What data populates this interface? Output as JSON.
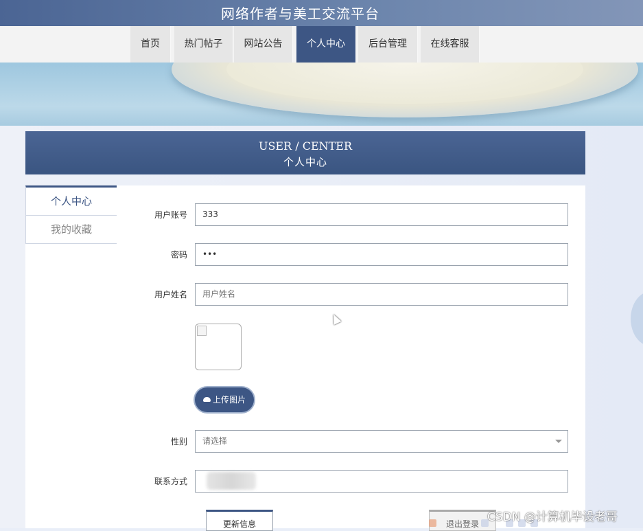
{
  "site": {
    "title": "网络作者与美工交流平台"
  },
  "nav": {
    "items": [
      {
        "label": "首页",
        "active": false
      },
      {
        "label": "热门帖子",
        "active": false
      },
      {
        "label": "网站公告",
        "active": false
      },
      {
        "label": "个人中心",
        "active": true
      },
      {
        "label": "后台管理",
        "active": false
      },
      {
        "label": "在线客服",
        "active": false
      }
    ]
  },
  "header": {
    "en": "USER / CENTER",
    "zh": "个人中心"
  },
  "side_menu": {
    "items": [
      {
        "label": "个人中心",
        "active": true
      },
      {
        "label": "我的收藏",
        "active": false
      }
    ]
  },
  "form": {
    "username": {
      "label": "用户账号",
      "value": "333"
    },
    "password": {
      "label": "密码",
      "value": "•••"
    },
    "realname": {
      "label": "用户姓名",
      "placeholder": "用户姓名"
    },
    "upload": {
      "label": "上传图片"
    },
    "gender": {
      "label": "性别",
      "value": "请选择"
    },
    "contact": {
      "label": "联系方式"
    },
    "update_button": "更新信息",
    "logout_button": "退出登录"
  },
  "watermark": "CSDN @计算机毕设老哥",
  "colors": {
    "primary": "#3d5684",
    "nav_bg": "#e6e6e6"
  }
}
